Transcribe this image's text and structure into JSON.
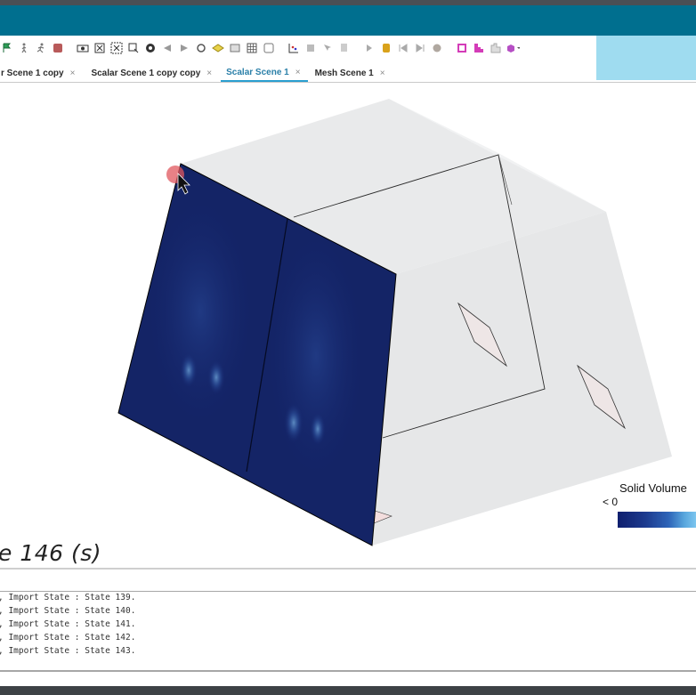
{
  "toolbar": {
    "icons": [
      "flag-icon",
      "walk-icon",
      "run-icon",
      "stop-icon",
      "camera-icon",
      "fit-icon",
      "zoom-box-icon",
      "select-icon",
      "snapshot-icon",
      "arrow-left-icon",
      "arrow-right-icon",
      "rotate-icon",
      "diamond-icon",
      "grid-a-icon",
      "grid-b-icon",
      "grid-c-icon",
      "scatter-icon",
      "probe-icon",
      "pick-icon",
      "lasso-icon",
      "play-icon",
      "record-icon",
      "step-back-icon",
      "step-forward-icon",
      "dot-icon",
      "bar-a-icon",
      "bar-b-icon",
      "bar-c-icon",
      "cube-dropdown-icon"
    ]
  },
  "tabs": [
    {
      "label": "r Scene 1 copy",
      "close": "×"
    },
    {
      "label": "Scalar Scene 1 copy copy",
      "close": "×"
    },
    {
      "label": "Scalar Scene 1",
      "close": "×"
    },
    {
      "label": "Mesh Scene 1",
      "close": "×"
    }
  ],
  "scene": {
    "time_label": "e 146 (s)",
    "legend": {
      "title": "Solid Volume",
      "min_label": "< 0"
    }
  },
  "console": {
    "lines": [
      ", Import State : State 139.",
      ", Import State : State 140.",
      ", Import State : State 141.",
      ", Import State : State 142.",
      ", Import State : State 143."
    ]
  },
  "colors": {
    "title_bar": "#006f8f",
    "right_panel": "#9fdcf0",
    "active_tab": "#2a7fa8",
    "contour_dark": "#0f1f6e"
  }
}
